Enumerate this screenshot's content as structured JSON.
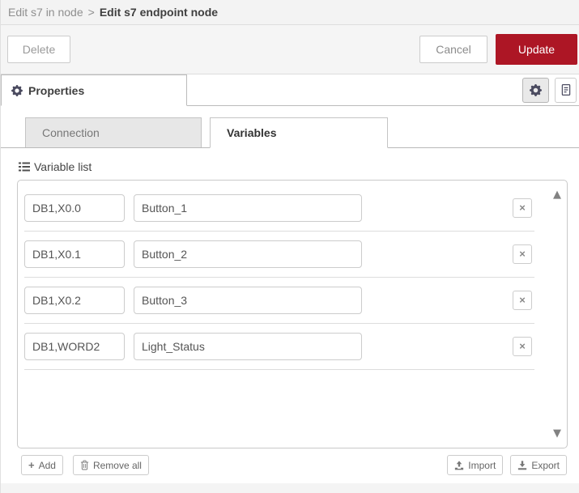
{
  "header": {
    "breadcrumb": {
      "parent": "Edit s7 in node",
      "separator": ">",
      "current": "Edit s7 endpoint node"
    }
  },
  "toolbar": {
    "delete_label": "Delete",
    "cancel_label": "Cancel",
    "update_label": "Update"
  },
  "editor_nav": {
    "properties_tab_label": "Properties"
  },
  "subtabs": [
    {
      "label": "Connection",
      "active": false
    },
    {
      "label": "Variables",
      "active": true
    }
  ],
  "variables": {
    "section_title": "Variable list",
    "rows": [
      {
        "address": "DB1,X0.0",
        "name": "Button_1"
      },
      {
        "address": "DB1,X0.1",
        "name": "Button_2"
      },
      {
        "address": "DB1,X0.2",
        "name": "Button_3"
      },
      {
        "address": "DB1,WORD2",
        "name": "Light_Status"
      }
    ],
    "footer": {
      "add_label": "Add",
      "remove_all_label": "Remove all",
      "import_label": "Import",
      "export_label": "Export"
    }
  },
  "icons": {
    "properties_tab": "gear-icon",
    "node_settings": "gear-icon",
    "node_description": "document-icon",
    "variable_list": "list-icon",
    "add": "plus-icon",
    "remove_all": "trash-icon",
    "import": "upload-icon",
    "export": "download-icon",
    "remove_row": "x-icon",
    "plus_glyph": "+",
    "remove_row_glyph": "×",
    "scroll_up_glyph": "▲",
    "scroll_down_glyph": "▼"
  },
  "colors": {
    "accent_red": "#AD1625",
    "header_bg": "#f3f3f3",
    "tab_border": "#bbbbbb",
    "input_border": "#cccccc"
  }
}
